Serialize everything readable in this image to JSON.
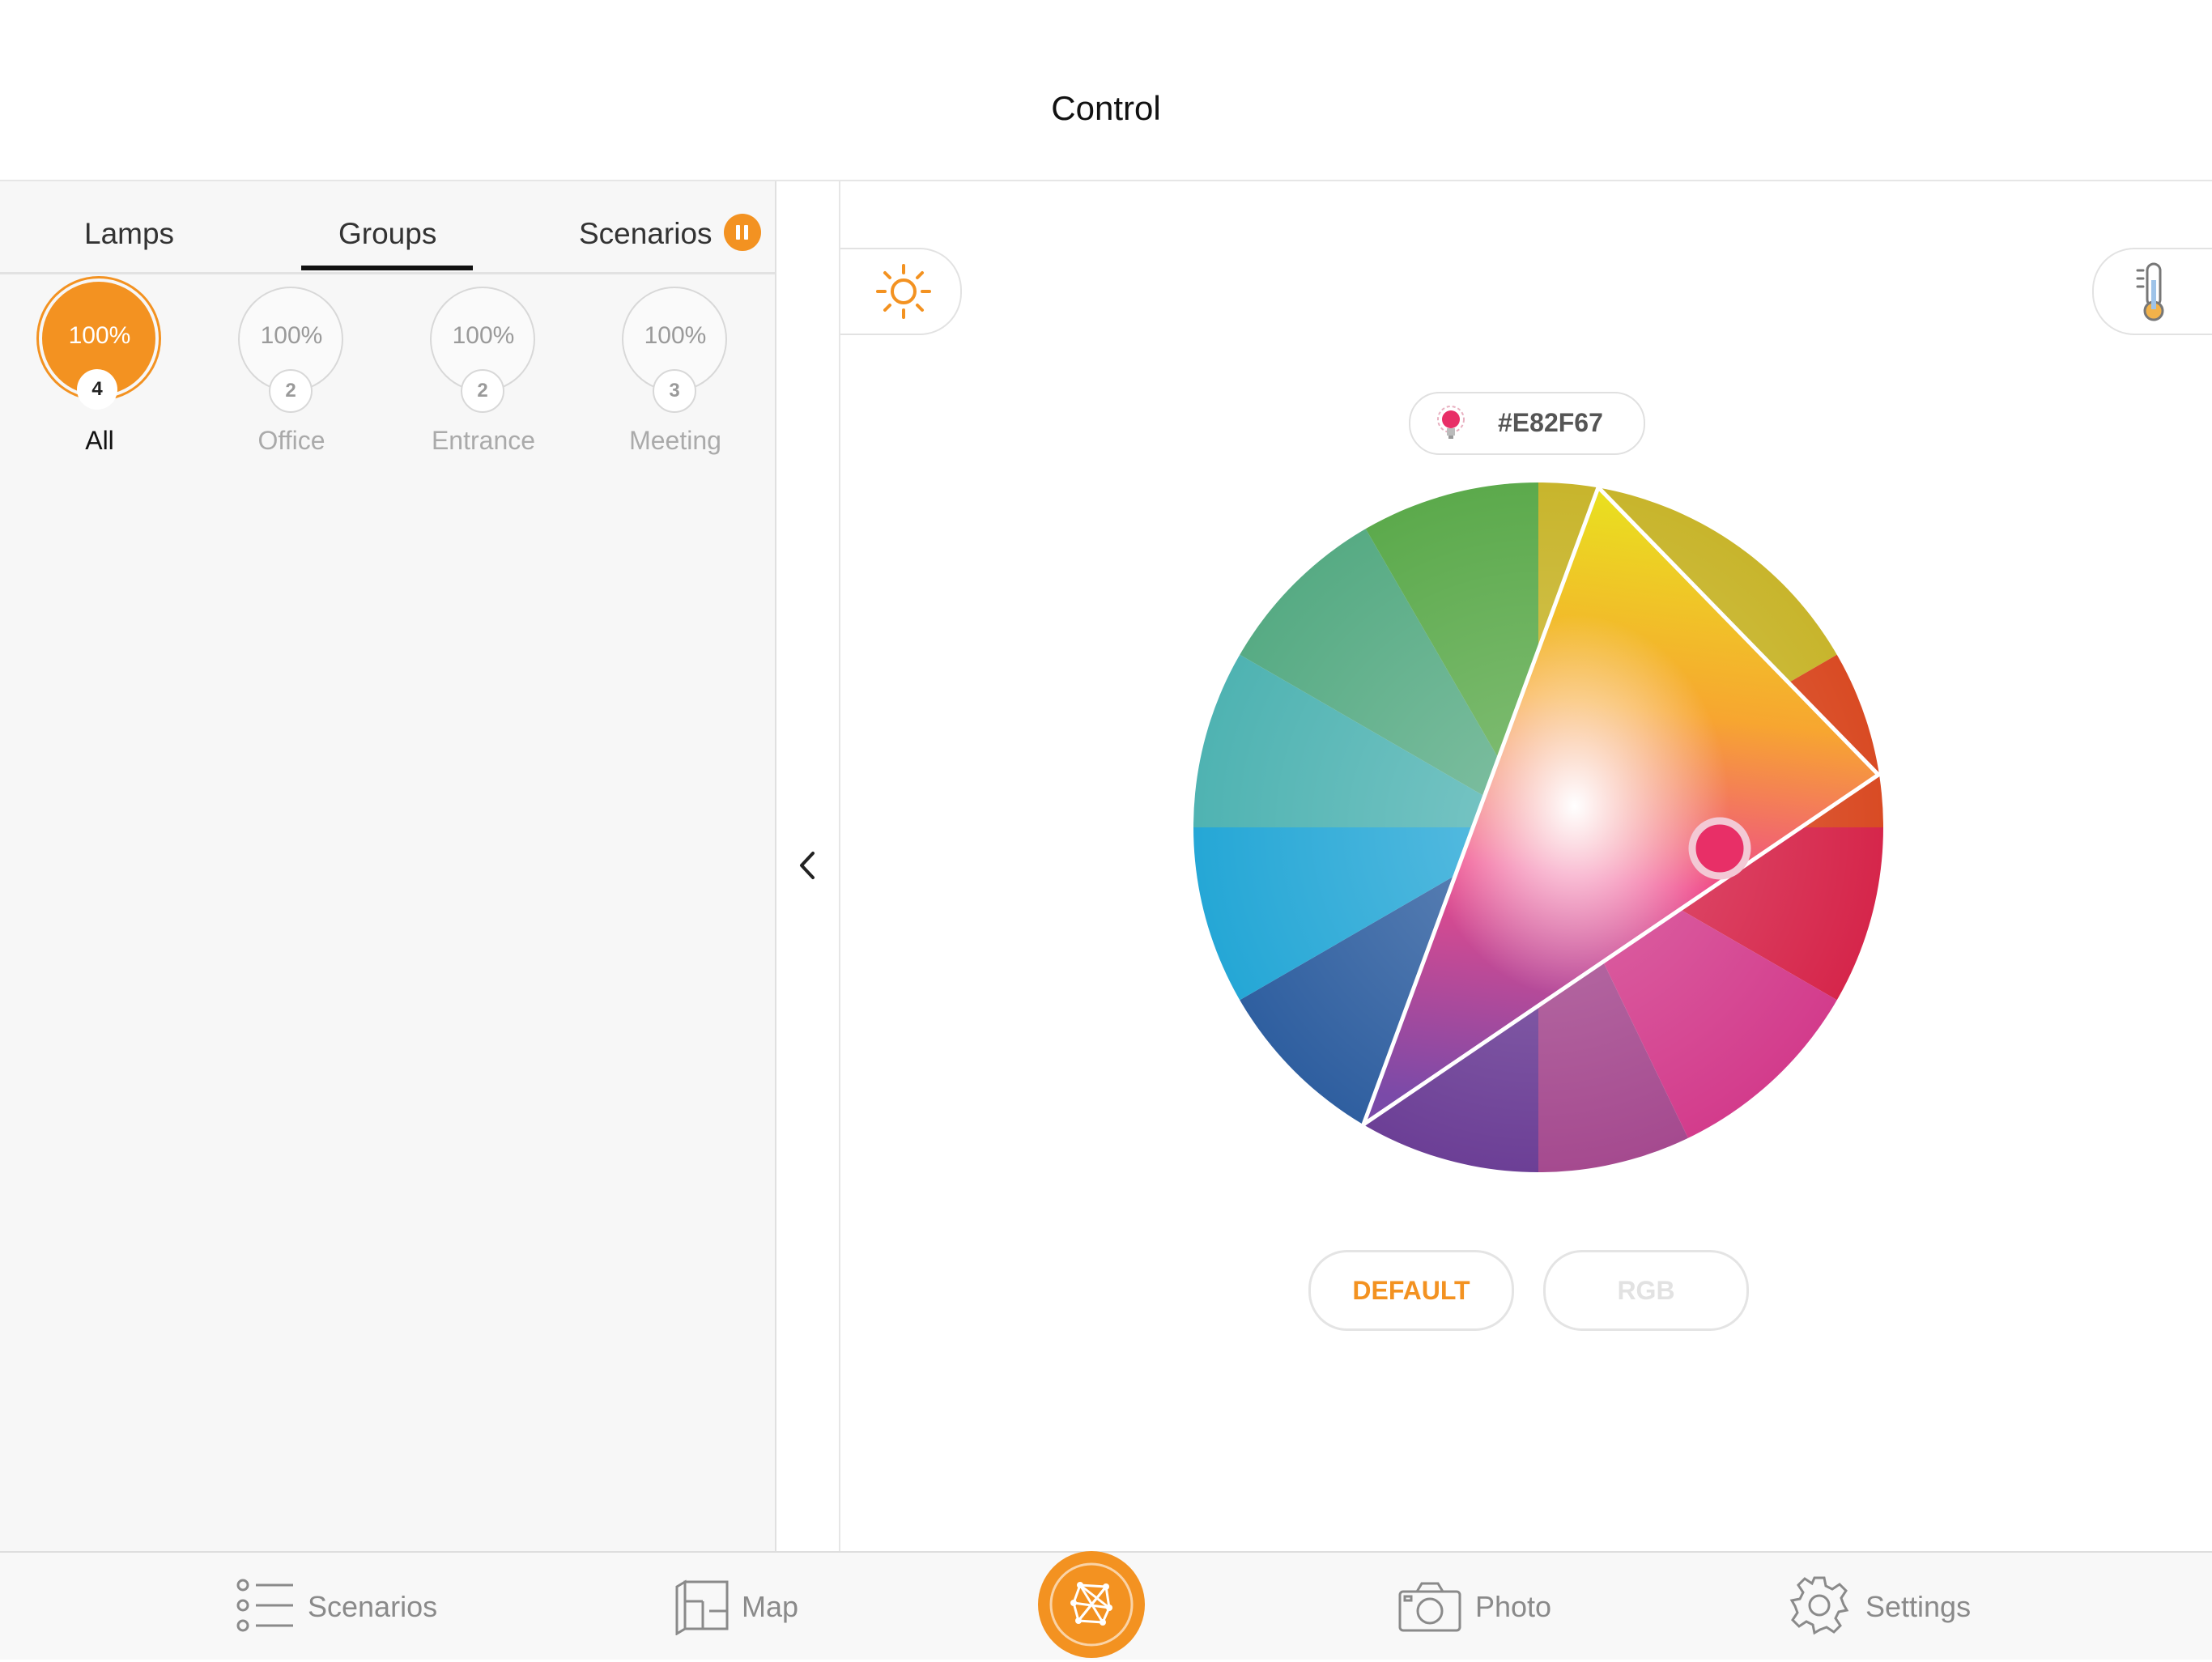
{
  "header": {
    "title": "Control"
  },
  "tabs": [
    {
      "label": "Lamps"
    },
    {
      "label": "Groups"
    },
    {
      "label": "Scenarios"
    }
  ],
  "groups": [
    {
      "name": "All",
      "percent": "100%",
      "count": "4",
      "active": true
    },
    {
      "name": "Office",
      "percent": "100%",
      "count": "2",
      "active": false
    },
    {
      "name": "Entrance",
      "percent": "100%",
      "count": "2",
      "active": false
    },
    {
      "name": "Meeting",
      "percent": "100%",
      "count": "3",
      "active": false
    }
  ],
  "color": {
    "hex": "#E82F67",
    "accent": "#F39221"
  },
  "buttons": {
    "default": "DEFAULT",
    "rgb": "RGB"
  },
  "bottom_nav": [
    {
      "label": "Scenarios",
      "icon": "list-icon"
    },
    {
      "label": "Map",
      "icon": "floorplan-icon"
    },
    {
      "label": "",
      "icon": "network-icon"
    },
    {
      "label": "Photo",
      "icon": "camera-icon"
    },
    {
      "label": "Settings",
      "icon": "gear-icon"
    }
  ]
}
